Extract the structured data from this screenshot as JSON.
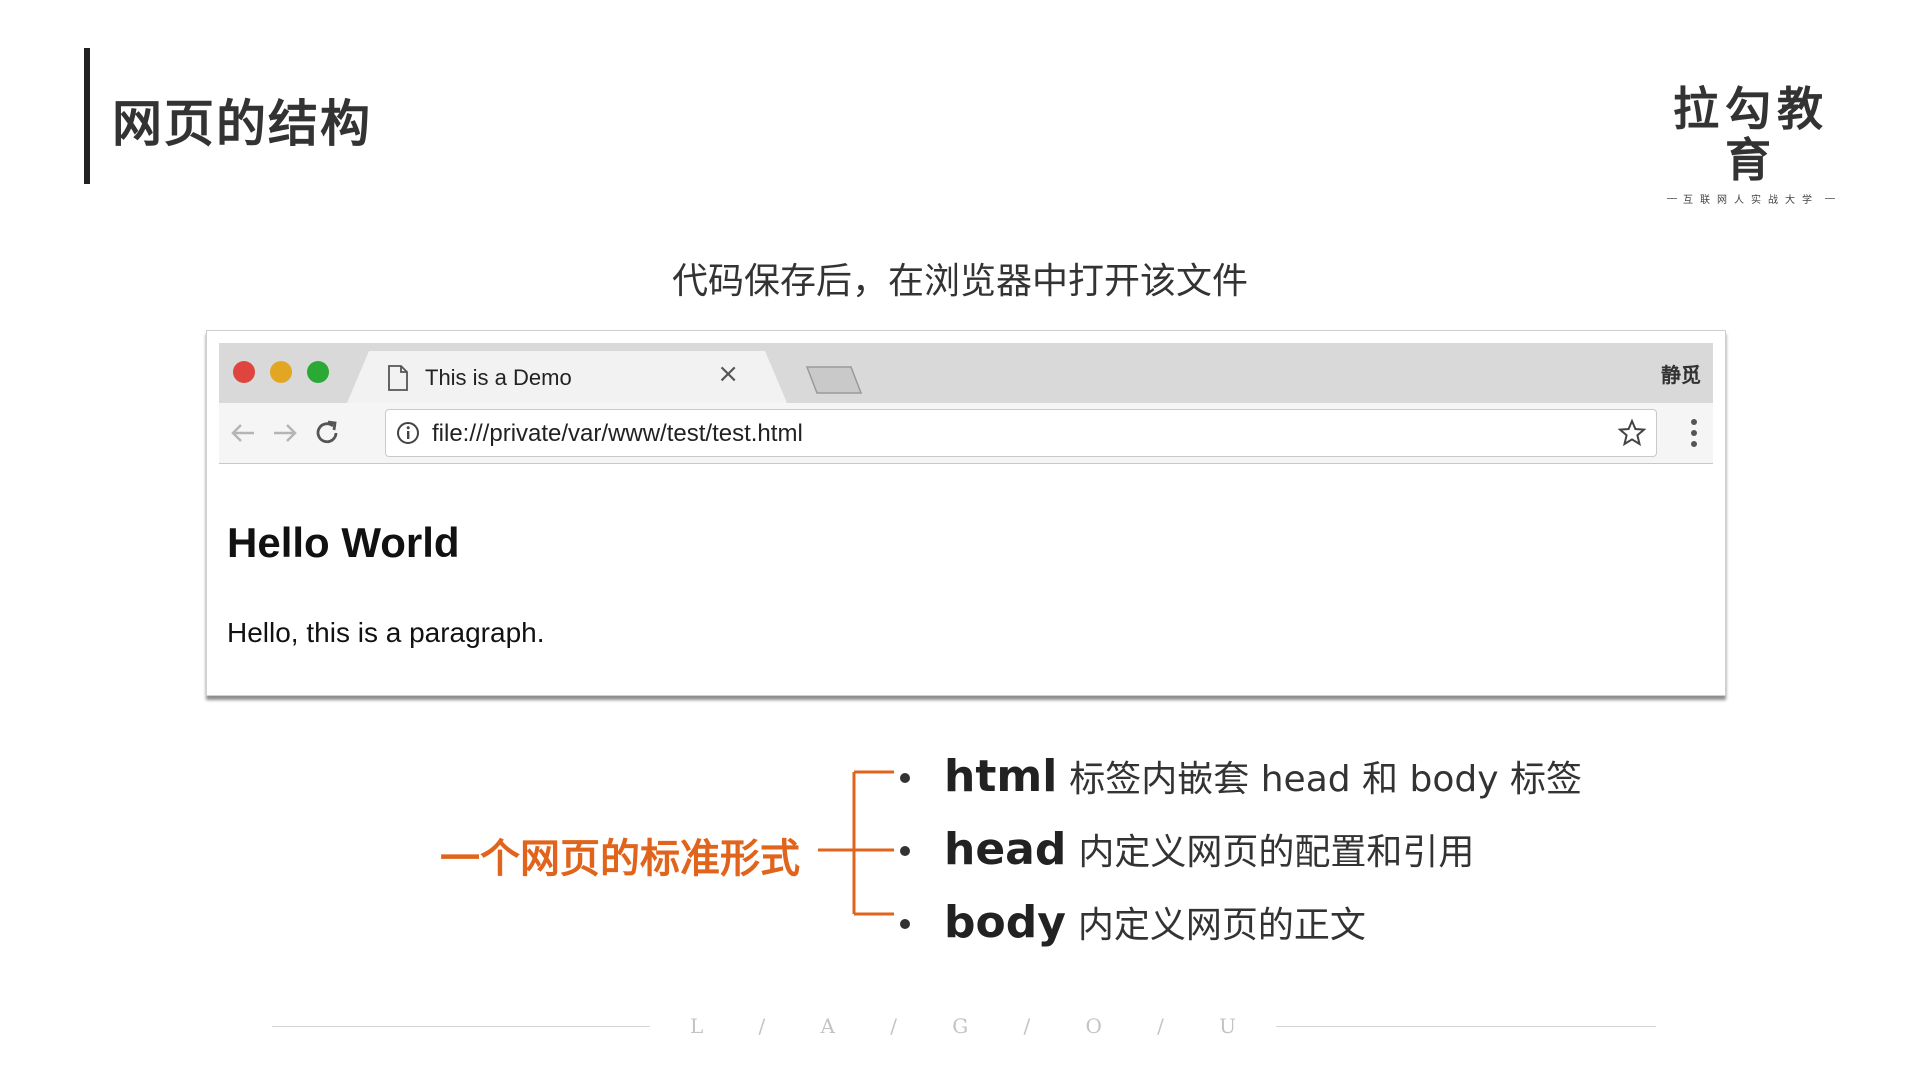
{
  "slide": {
    "title": "网页的结构",
    "caption": "代码保存后，在浏览器中打开该文件"
  },
  "logo": {
    "main": "拉勾教育",
    "sub": "互联网人实战大学"
  },
  "browser": {
    "tab_title": "This is a Demo",
    "tab_close": "×",
    "profile_name": "静觅",
    "url": "file:///private/var/www/test/test.html",
    "page": {
      "heading": "Hello World",
      "paragraph": "Hello, this is a paragraph."
    },
    "icons": {
      "back": "back-arrow-icon",
      "forward": "forward-arrow-icon",
      "reload": "reload-icon",
      "info": "info-icon",
      "star": "star-icon",
      "menu": "more-vertical-icon",
      "document": "document-icon"
    }
  },
  "structure": {
    "label": "一个网页的标准形式",
    "accent_color": "#e0641c",
    "items": [
      {
        "key": "html",
        "desc": "标签内嵌套 head 和 body 标签"
      },
      {
        "key": "head",
        "desc": "内定义网页的配置和引用"
      },
      {
        "key": "body",
        "desc": "内定义网页的正文"
      }
    ]
  },
  "footer": {
    "letters": [
      "L",
      "/",
      "A",
      "/",
      "G",
      "/",
      "O",
      "/",
      "U"
    ]
  }
}
